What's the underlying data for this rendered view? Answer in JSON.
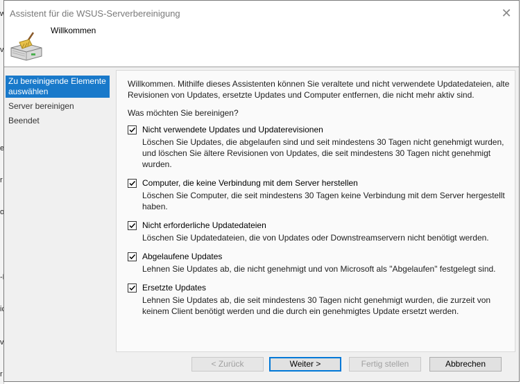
{
  "window": {
    "title": "Assistent für die WSUS-Serverbereinigung",
    "header_title": "Willkommen"
  },
  "background_fragments": [
    "w",
    "v",
    "e",
    "r",
    "o",
    "-E",
    "ic",
    "v",
    "r"
  ],
  "nav": {
    "items": [
      {
        "label": "Zu bereinigende Elemente auswählen",
        "active": true
      },
      {
        "label": "Server bereinigen",
        "active": false
      },
      {
        "label": "Beendet",
        "active": false
      }
    ]
  },
  "content": {
    "intro": "Willkommen. Mithilfe dieses Assistenten können Sie veraltete und nicht verwendete Updatedateien, alte Revisionen von Updates, ersetzte Updates und Computer entfernen, die nicht mehr aktiv sind.",
    "question": "Was möchten Sie bereinigen?",
    "options": [
      {
        "label": "Nicht verwendete Updates und Updaterevisionen",
        "description": "Löschen Sie Updates, die abgelaufen sind und seit mindestens 30 Tagen nicht genehmigt wurden, und löschen Sie ältere Revisionen von Updates, die seit mindestens 30 Tagen nicht genehmigt wurden.",
        "checked": true
      },
      {
        "label": "Computer, die keine Verbindung mit dem Server herstellen",
        "description": "Löschen Sie Computer, die seit mindestens 30 Tagen keine Verbindung mit dem Server hergestellt haben.",
        "checked": true
      },
      {
        "label": "Nicht erforderliche Updatedateien",
        "description": "Löschen Sie Updatedateien, die von Updates oder Downstreamservern nicht benötigt werden.",
        "checked": true
      },
      {
        "label": "Abgelaufene Updates",
        "description": "Lehnen Sie Updates ab, die nicht genehmigt und von Microsoft als \"Abgelaufen\" festgelegt sind.",
        "checked": true
      },
      {
        "label": "Ersetzte Updates",
        "description": "Lehnen Sie Updates ab, die seit mindestens 30 Tagen nicht genehmigt wurden, die zurzeit von keinem Client benötigt werden und die durch ein genehmigtes Update ersetzt werden.",
        "checked": true
      }
    ]
  },
  "buttons": {
    "back": "< Zurück",
    "next": "Weiter >",
    "finish": "Fertig stellen",
    "cancel": "Abbrechen"
  },
  "icons": {
    "close": "close-icon",
    "header": "server-cleanup-icon"
  },
  "colors": {
    "nav_active": "#1979ca",
    "default_button_border": "#0078d7"
  }
}
